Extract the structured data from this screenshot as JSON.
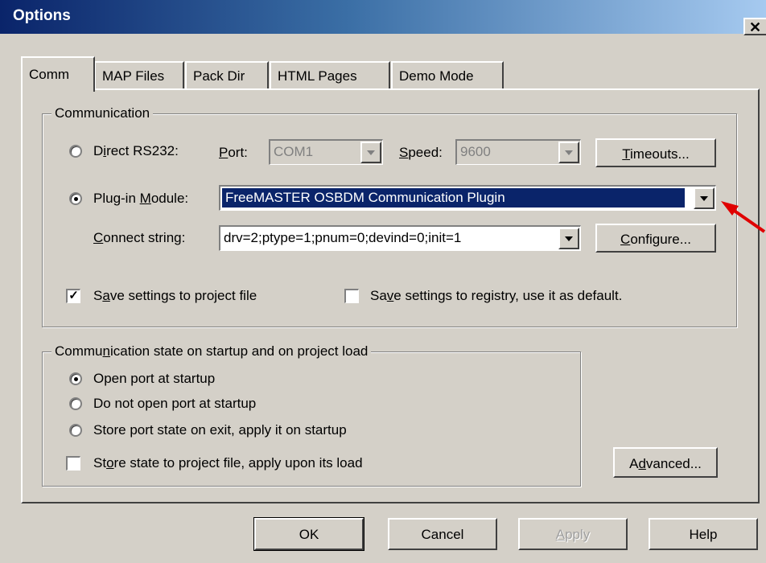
{
  "window": {
    "title": "Options",
    "close_glyph": "✕"
  },
  "tabs": [
    {
      "label": "Comm",
      "active": true
    },
    {
      "label": "MAP Files"
    },
    {
      "label": "Pack Dir"
    },
    {
      "label": "HTML Pages"
    },
    {
      "label": "Demo Mode"
    }
  ],
  "communication": {
    "group_label": "Communication",
    "direct": {
      "label_pre": "D",
      "label_u": "i",
      "label_post": "rect RS232:",
      "selected": false,
      "port_label": "Port:",
      "port_value": "COM1",
      "speed_label": "Speed:",
      "speed_value": "9600"
    },
    "timeouts_button": "Timeouts...",
    "plugin": {
      "label_pre": "Plug-in ",
      "label_u": "M",
      "label_post": "odule:",
      "selected": true,
      "value": "FreeMASTER OSBDM Communication Plugin"
    },
    "connect": {
      "label_u": "C",
      "label_post": "onnect string:",
      "value": "drv=2;ptype=1;pnum=0;devind=0;init=1"
    },
    "configure_button": "Configure...",
    "save_project": {
      "label_pre": "S",
      "label_u": "a",
      "label_post": "ve settings to project file",
      "checked": true
    },
    "save_registry": {
      "label_pre": "Sa",
      "label_u": "v",
      "label_post": "e settings to registry, use it as default.",
      "checked": false
    }
  },
  "startup": {
    "group_label_pre": "Commu",
    "group_label_u": "n",
    "group_label_post": "ication state on startup and on project load",
    "options": [
      {
        "label": "Open port at startup",
        "selected": true
      },
      {
        "label": "Do not open port at startup",
        "selected": false
      },
      {
        "label": "Store port state on exit, apply it on startup",
        "selected": false
      }
    ],
    "store_state": {
      "label_pre": "St",
      "label_u": "o",
      "label_post": "re state to project file, apply upon its load",
      "checked": false
    }
  },
  "advanced_button": {
    "pre": "A",
    "u": "d",
    "post": "vanced..."
  },
  "footer": {
    "ok": "OK",
    "cancel": "Cancel",
    "apply": "Apply",
    "help": "Help"
  },
  "colors": {
    "accent": "#0a246a",
    "arrow": "#e00000"
  }
}
